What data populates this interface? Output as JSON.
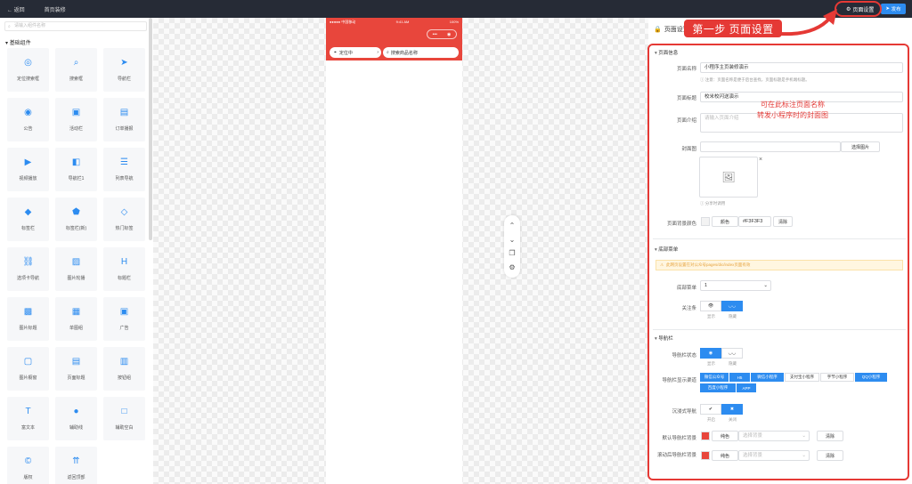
{
  "topbar": {
    "back": "← 返回",
    "title": "首页装修",
    "settings": "页面设置",
    "publish": "发布"
  },
  "left": {
    "search_placeholder": "请输入组件名称",
    "group": "基础组件",
    "items": [
      {
        "label": "定位搜索框",
        "icon": "◎"
      },
      {
        "label": "搜索框",
        "icon": "⌕"
      },
      {
        "label": "导航栏",
        "icon": "➤"
      },
      {
        "label": "公告",
        "icon": "◉"
      },
      {
        "label": "活动栏",
        "icon": "▣"
      },
      {
        "label": "订单播报",
        "icon": "▤"
      },
      {
        "label": "视频播放",
        "icon": "▶"
      },
      {
        "label": "导航栏1",
        "icon": "◧"
      },
      {
        "label": "列表导航",
        "icon": "☰"
      },
      {
        "label": "标签栏",
        "icon": "◆"
      },
      {
        "label": "标签栏(新)",
        "icon": "⬟"
      },
      {
        "label": "热门标签",
        "icon": "◇"
      },
      {
        "label": "选项卡导航",
        "icon": "⛓"
      },
      {
        "label": "图片轮播",
        "icon": "▨"
      },
      {
        "label": "标题栏",
        "icon": "H"
      },
      {
        "label": "图片标题",
        "icon": "▩"
      },
      {
        "label": "单图组",
        "icon": "▦"
      },
      {
        "label": "广告",
        "icon": "▣"
      },
      {
        "label": "图片橱窗",
        "icon": "▢"
      },
      {
        "label": "页面标题",
        "icon": "▤"
      },
      {
        "label": "按钮组",
        "icon": "▥"
      },
      {
        "label": "富文本",
        "icon": "T"
      },
      {
        "label": "辅助线",
        "icon": "●"
      },
      {
        "label": "辅助空白",
        "icon": "□"
      },
      {
        "label": "版权",
        "icon": "©"
      },
      {
        "label": "返回顶部",
        "icon": "⇈"
      }
    ]
  },
  "phone": {
    "carrier": "●●●●● 中国移动",
    "time": "9:41 AM",
    "battery": "100%",
    "location": "定位中",
    "search": "搜索商品名称"
  },
  "right": {
    "header": "页面设置",
    "step_label": "第一步 页面设置",
    "annotation_line1": "可在此标注页面名称",
    "annotation_line2": "转发小程序时的封面图",
    "section_info": "页面信息",
    "name_label": "页面名称",
    "name_value": "小程序主页装修演示",
    "name_hint": "注意：页面名称是便于后台查找，页面标题是手机端标题。",
    "title_label": "页面标题",
    "title_value": "校米校闪送演示",
    "intro_label": "页面介绍",
    "intro_placeholder": "请输入页面介绍",
    "cover_label": "封面图",
    "choose_image": "选择图片",
    "share_hint": "分享时调用",
    "bg_label": "页面背景颜色",
    "bg_color_btn": "颜色",
    "bg_color_value": "#F3F3F3",
    "bg_clear": "清除",
    "section_bottom": "底部菜单",
    "bottom_notice": "此网页设置在对公众号pages/dic/index页面有效",
    "bottom_menu_label": "底部菜单",
    "bottom_menu_value": "1",
    "follow_label": "关注条",
    "follow_show": "显示",
    "follow_hide": "隐藏",
    "section_nav": "导航栏",
    "nav_state_label": "导航栏状态",
    "nav_show": "显示",
    "nav_hide": "隐藏",
    "nav_channel_label": "导航栏显示渠道",
    "channels": [
      {
        "label": "微信公众号",
        "on": true
      },
      {
        "label": "H5",
        "on": true
      },
      {
        "label": "微信小程序",
        "on": true
      },
      {
        "label": "支付宝小程序",
        "on": false
      },
      {
        "label": "字节小程序",
        "on": false
      },
      {
        "label": "QQ小程序",
        "on": true
      },
      {
        "label": "百度小程序",
        "on": true
      },
      {
        "label": "APP",
        "on": true
      }
    ],
    "immersive_label": "沉浸式导航",
    "immersive_on": "开启",
    "immersive_off": "关闭",
    "default_bg_label": "默认导航栏背景",
    "default_bg_color": "#e8463c",
    "color_btn": "纯色",
    "bg_placeholder": "选择背景",
    "clear": "清除",
    "scroll_bg_label": "滚动后导航栏背景",
    "scroll_bg_color": "#e8463c"
  }
}
